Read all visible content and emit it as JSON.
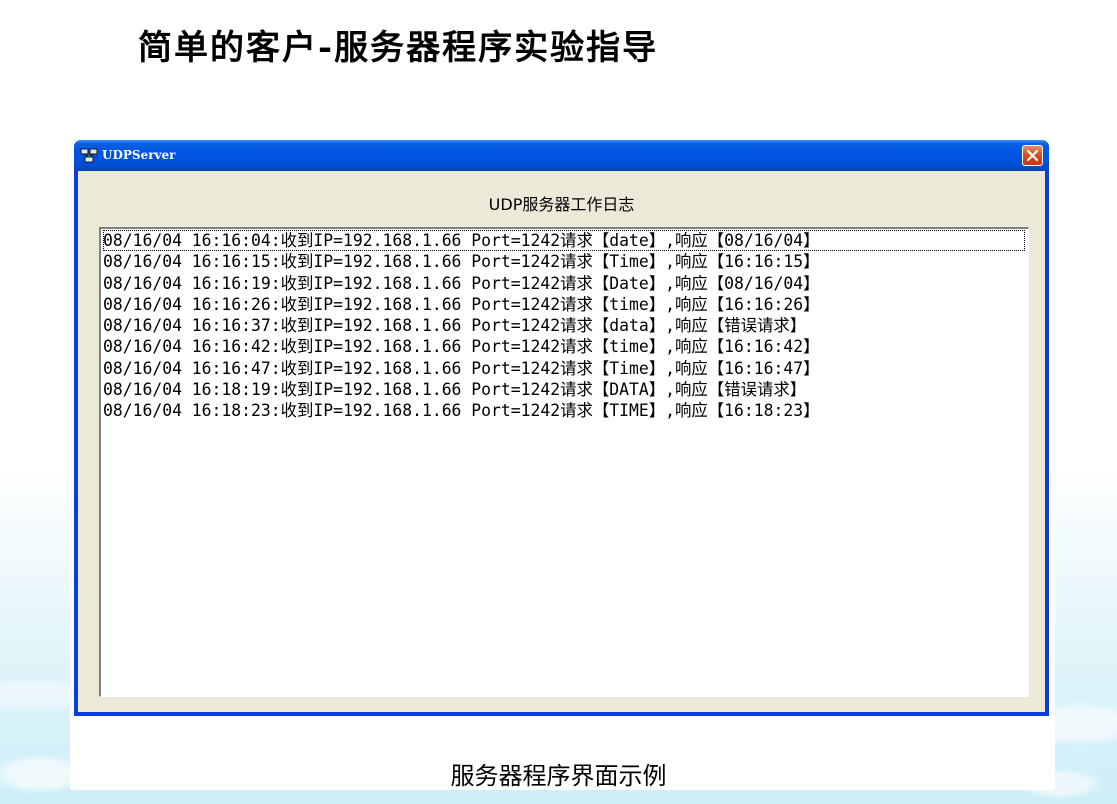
{
  "slide": {
    "title": "简单的客户-服务器程序实验指导",
    "caption": "服务器程序界面示例"
  },
  "window": {
    "title": "UDPServer",
    "close_icon": "close-icon",
    "app_icon": "network-computers-icon"
  },
  "log": {
    "heading": "UDP服务器工作日志",
    "lines": [
      "08/16/04 16:16:04:收到IP=192.168.1.66 Port=1242请求【date】,响应【08/16/04】",
      "08/16/04 16:16:15:收到IP=192.168.1.66 Port=1242请求【Time】,响应【16:16:15】",
      "08/16/04 16:16:19:收到IP=192.168.1.66 Port=1242请求【Date】,响应【08/16/04】",
      "08/16/04 16:16:26:收到IP=192.168.1.66 Port=1242请求【time】,响应【16:16:26】",
      "08/16/04 16:16:37:收到IP=192.168.1.66 Port=1242请求【data】,响应【错误请求】",
      "08/16/04 16:16:42:收到IP=192.168.1.66 Port=1242请求【time】,响应【16:16:42】",
      "08/16/04 16:16:47:收到IP=192.168.1.66 Port=1242请求【Time】,响应【16:16:47】",
      "08/16/04 16:18:19:收到IP=192.168.1.66 Port=1242请求【DATA】,响应【错误请求】",
      "08/16/04 16:18:23:收到IP=192.168.1.66 Port=1242请求【TIME】,响应【16:18:23】"
    ]
  },
  "colors": {
    "titlebar": "#0054e3",
    "window_face": "#ece9d8",
    "close_button": "#d8491f"
  }
}
